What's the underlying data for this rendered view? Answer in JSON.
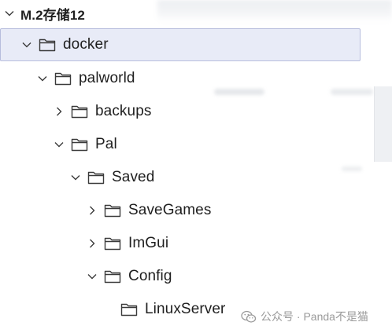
{
  "tree": {
    "root": {
      "label": "M.2存储12",
      "expanded": true
    },
    "items": [
      {
        "label": "docker",
        "expanded": true,
        "selected": true
      },
      {
        "label": "palworld",
        "expanded": true
      },
      {
        "label": "backups",
        "expanded": false
      },
      {
        "label": "Pal",
        "expanded": true
      },
      {
        "label": "Saved",
        "expanded": true
      },
      {
        "label": "SaveGames",
        "expanded": false
      },
      {
        "label": "ImGui",
        "expanded": false
      },
      {
        "label": "Config",
        "expanded": true
      },
      {
        "label": "LinuxServer"
      }
    ]
  },
  "watermark": {
    "text": "公众号 · Panda不是猫",
    "icon": "wechat-icon"
  },
  "colors": {
    "selected_bg": "#e8ebf7",
    "selected_border": "#b7bddd",
    "text": "#1f1f1f",
    "icon_stroke": "#3a3a3a",
    "watermark": "#9a9a9a"
  }
}
